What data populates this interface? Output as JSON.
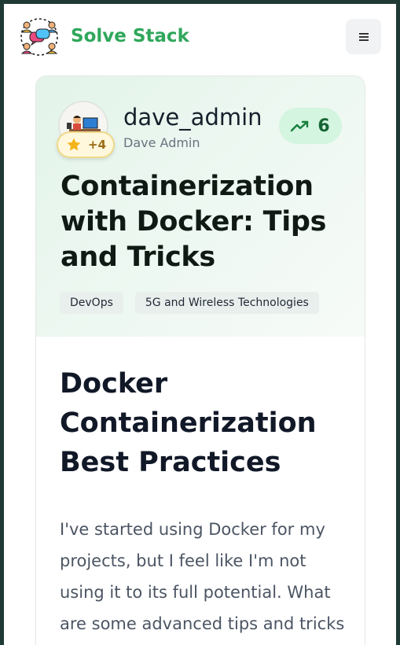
{
  "header": {
    "brand": "Solve Stack",
    "logo_icon": "people-chat-icon",
    "menu_icon": "hamburger-icon"
  },
  "post": {
    "author": {
      "username": "dave_admin",
      "full_name": "Dave Admin",
      "avatar_icon": "person-at-desk-avatar",
      "xp_badge": "+4",
      "xp_icon": "star-icon"
    },
    "score": "6",
    "score_icon": "trending-up-icon",
    "title": "Containerization with Docker: Tips and Tricks",
    "tags": [
      "DevOps",
      "5G and Wireless Technologies"
    ],
    "heading": "Docker Containerization Best Practices",
    "body_text": "I've started using Docker for my projects, but I feel like I'm not using it to its full potential. What are some advanced tips and tricks for"
  },
  "colors": {
    "brand_green": "#2fa75b",
    "score_bg": "#d4f5df",
    "score_text": "#166534",
    "badge_bg": "#fff8dd",
    "page_frame": "#1f3a35"
  }
}
